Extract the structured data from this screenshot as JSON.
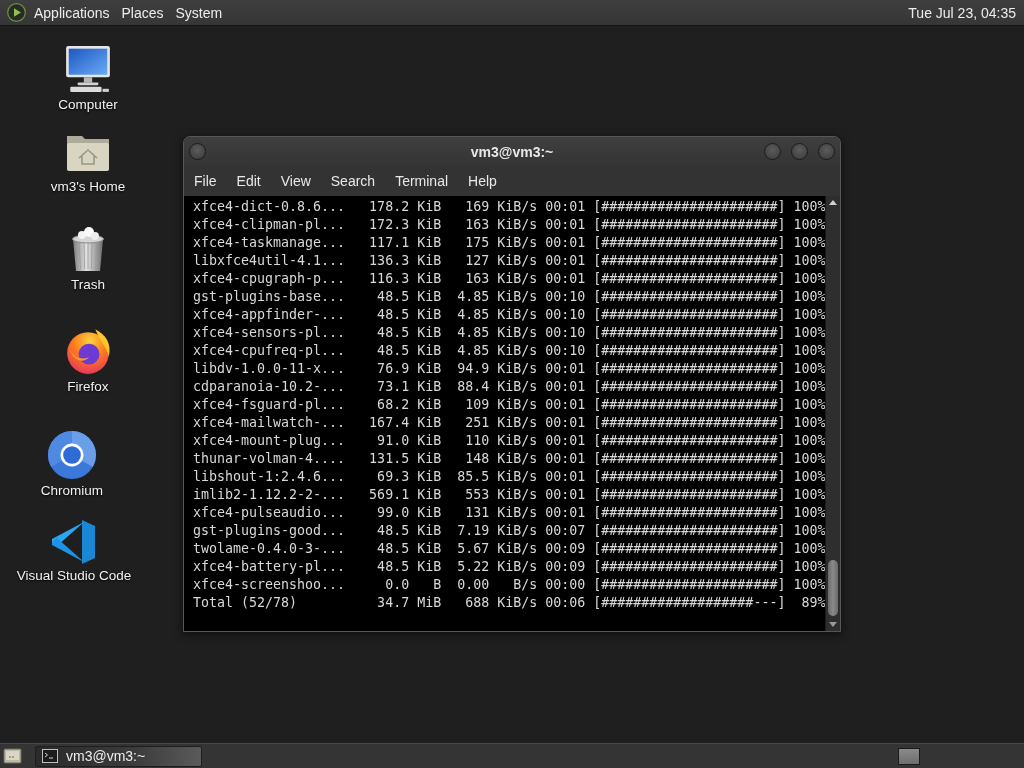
{
  "top_panel": {
    "menus": [
      {
        "label": "Applications"
      },
      {
        "label": "Places"
      },
      {
        "label": "System"
      }
    ],
    "clock": "Tue Jul 23, 04:35"
  },
  "desktop_icons": [
    {
      "kind": "monitor",
      "label": "Computer"
    },
    {
      "kind": "folder",
      "label": "vm3's Home"
    },
    {
      "kind": "trash",
      "label": "Trash"
    },
    {
      "kind": "fox",
      "label": "Firefox"
    },
    {
      "kind": "ring",
      "label": "Chromium"
    },
    {
      "kind": "ribbon",
      "label": "Visual Studio Code"
    }
  ],
  "terminal": {
    "title": "vm3@vm3:~",
    "menu": [
      "File",
      "Edit",
      "View",
      "Search",
      "Terminal",
      "Help"
    ],
    "lines": [
      "xfce4-dict-0.8.6...   178.2 KiB   169 KiB/s 00:01 [######################] 100%",
      "xfce4-clipman-pl...   172.3 KiB   163 KiB/s 00:01 [######################] 100%",
      "xfce4-taskmanage...   117.1 KiB   175 KiB/s 00:01 [######################] 100%",
      "libxfce4util-4.1...   136.3 KiB   127 KiB/s 00:01 [######################] 100%",
      "xfce4-cpugraph-p...   116.3 KiB   163 KiB/s 00:01 [######################] 100%",
      "gst-plugins-base...    48.5 KiB  4.85 KiB/s 00:10 [######################] 100%",
      "xfce4-appfinder-...    48.5 KiB  4.85 KiB/s 00:10 [######################] 100%",
      "xfce4-sensors-pl...    48.5 KiB  4.85 KiB/s 00:10 [######################] 100%",
      "xfce4-cpufreq-pl...    48.5 KiB  4.85 KiB/s 00:10 [######################] 100%",
      "libdv-1.0.0-11-x...    76.9 KiB  94.9 KiB/s 00:01 [######################] 100%",
      "cdparanoia-10.2-...    73.1 KiB  88.4 KiB/s 00:01 [######################] 100%",
      "xfce4-fsguard-pl...    68.2 KiB   109 KiB/s 00:01 [######################] 100%",
      "xfce4-mailwatch-...   167.4 KiB   251 KiB/s 00:01 [######################] 100%",
      "xfce4-mount-plug...    91.0 KiB   110 KiB/s 00:01 [######################] 100%",
      "thunar-volman-4....   131.5 KiB   148 KiB/s 00:01 [######################] 100%",
      "libshout-1:2.4.6...    69.3 KiB  85.5 KiB/s 00:01 [######################] 100%",
      "imlib2-1.12.2-2-...   569.1 KiB   553 KiB/s 00:01 [######################] 100%",
      "xfce4-pulseaudio...    99.0 KiB   131 KiB/s 00:01 [######################] 100%",
      "gst-plugins-good...    48.5 KiB  7.19 KiB/s 00:07 [######################] 100%",
      "twolame-0.4.0-3-...    48.5 KiB  5.67 KiB/s 00:09 [######################] 100%",
      "xfce4-battery-pl...    48.5 KiB  5.22 KiB/s 00:09 [######################] 100%",
      "xfce4-screenshoo...     0.0   B  0.00   B/s 00:00 [######################] 100%",
      "Total (52/78)          34.7 MiB   688 KiB/s 00:06 [###################---]  89%"
    ]
  },
  "bottom_panel": {
    "tasks": [
      {
        "label": "vm3@vm3:~"
      }
    ]
  }
}
